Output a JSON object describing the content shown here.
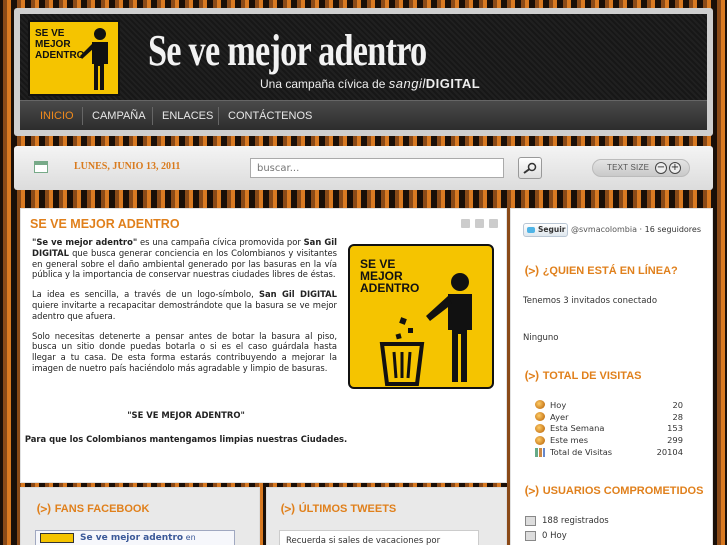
{
  "header": {
    "logo_text": [
      "SE VE",
      "MEJOR",
      "ADENTRO"
    ],
    "title": "Se ve mejor adentro",
    "subtitle_prefix": "Una campaña cívica de ",
    "subtitle_brand_a": "sangil",
    "subtitle_brand_b": "DIGITAL"
  },
  "nav": {
    "items": [
      {
        "label": "INICIO",
        "active": true
      },
      {
        "label": "CAMPAÑA",
        "active": false
      },
      {
        "label": "ENLACES",
        "active": false
      },
      {
        "label": "CONTÁCTENOS",
        "active": false
      }
    ]
  },
  "toolbar": {
    "date": "LUNES, JUNIO 13, 2011",
    "search_placeholder": "buscar...",
    "textsize_label": "TEXT SIZE",
    "minus": "−",
    "plus": "+"
  },
  "article": {
    "title": "SE VE MEJOR ADENTRO",
    "p1_b1": "\"Se ve mejor adentro\"",
    "p1_t1": " es una campaña cívica promovida por ",
    "p1_b2": "San Gil DIGITAL",
    "p1_t2": " que busca generar conciencia en los Colombianos y visitantes en general sobre el daño ambiental generado por las basuras en la vía pública y la importancia de conservar nuestras ciudades libres de éstas.",
    "p2_t1": "La idea es sencilla, a través de un logo-símbolo, ",
    "p2_b1": "San Gil DIGITAL",
    "p2_t2": " quiere invitarte a recapacitar demostrándote que la basura se ve mejor adentro que afuera.",
    "p3": "Solo necesitas detenerte a pensar antes de botar la basura al piso, busca un sitio donde puedas botarla o si es el caso guárdala hasta llegar a tu casa. De esta forma estarás contribuyendo a mejorar la imagen de nuetro país haciéndolo más agradable y limpio de basuras.",
    "quote1": "\"SE VE MEJOR ADENTRO\"",
    "quote2": "Para que los Colombianos mantengamos limpias nuestras Ciudades.",
    "image_text": [
      "SE VE",
      "MEJOR",
      "ADENTRO"
    ]
  },
  "bottom": {
    "fans_title": "FANS FACEBOOK",
    "fb_name": "Se ve mejor adentro",
    "fb_suffix": " en Facebook",
    "tweets_title": "ÚLTIMOS TWEETS",
    "tweet_text": "Recuerda si sales de vacaciones por"
  },
  "sidebar": {
    "follow_label": "Seguir",
    "follow_handle": "@svmacolombia",
    "followers": " · 16 seguidores",
    "online_title": "¿QUIEN ESTÁ EN LÍNEA?",
    "online_text": "Tenemos 3 invitados conectado",
    "online_members": "Ninguno",
    "visits_title": "TOTAL DE VISITAS",
    "visits": [
      {
        "label": "Hoy",
        "value": "20"
      },
      {
        "label": "Ayer",
        "value": "28"
      },
      {
        "label": "Esta Semana",
        "value": "153"
      },
      {
        "label": "Este mes",
        "value": "299"
      },
      {
        "label": "Total de Visitas",
        "value": "20104"
      }
    ],
    "users_title": "USUARIOS COMPROMETIDOS",
    "registered": "188 registrados",
    "today": "0 Hoy"
  },
  "colors": {
    "accent": "#e0801c",
    "logo_yellow": "#f5c400"
  }
}
